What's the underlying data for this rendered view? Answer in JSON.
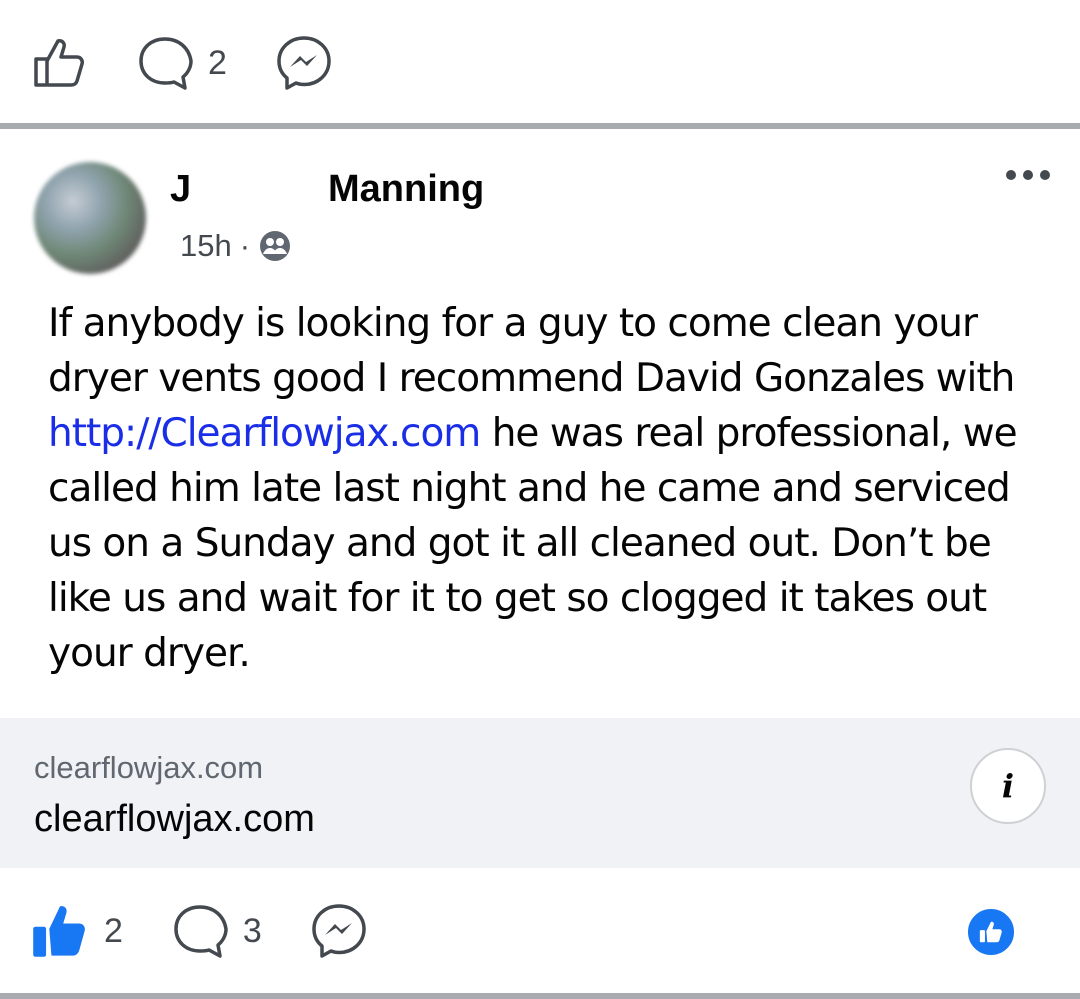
{
  "top_actions": {
    "comment_count": "2"
  },
  "post": {
    "author_first": "J",
    "author_last": "Manning",
    "time": "15h",
    "separator": "·",
    "text_before_link": "If anybody is looking for a guy to come clean your dryer vents good I recommend David Gonzales with ",
    "link": "http://Clearflowjax.com",
    "text_after_link": " he was real professional, we called him late last night and he came and serviced us on a Sunday and got it all cleaned out. Don’t be like us and wait for it to get so clogged it takes out your dryer."
  },
  "link_preview": {
    "domain": "clearflowjax.com",
    "title": "clearflowjax.com",
    "info_icon_glyph": "i"
  },
  "bottom_actions": {
    "like_count": "2",
    "comment_count": "3"
  },
  "icons": [
    "like-icon",
    "comment-icon",
    "messenger-icon",
    "audience-icon",
    "more-icon",
    "info-icon",
    "like-reaction-icon"
  ],
  "colors": {
    "link": "#1a2ee8",
    "accent": "#1877f2",
    "divider": "#a8acb1",
    "card_bg": "#f0f2f5"
  }
}
